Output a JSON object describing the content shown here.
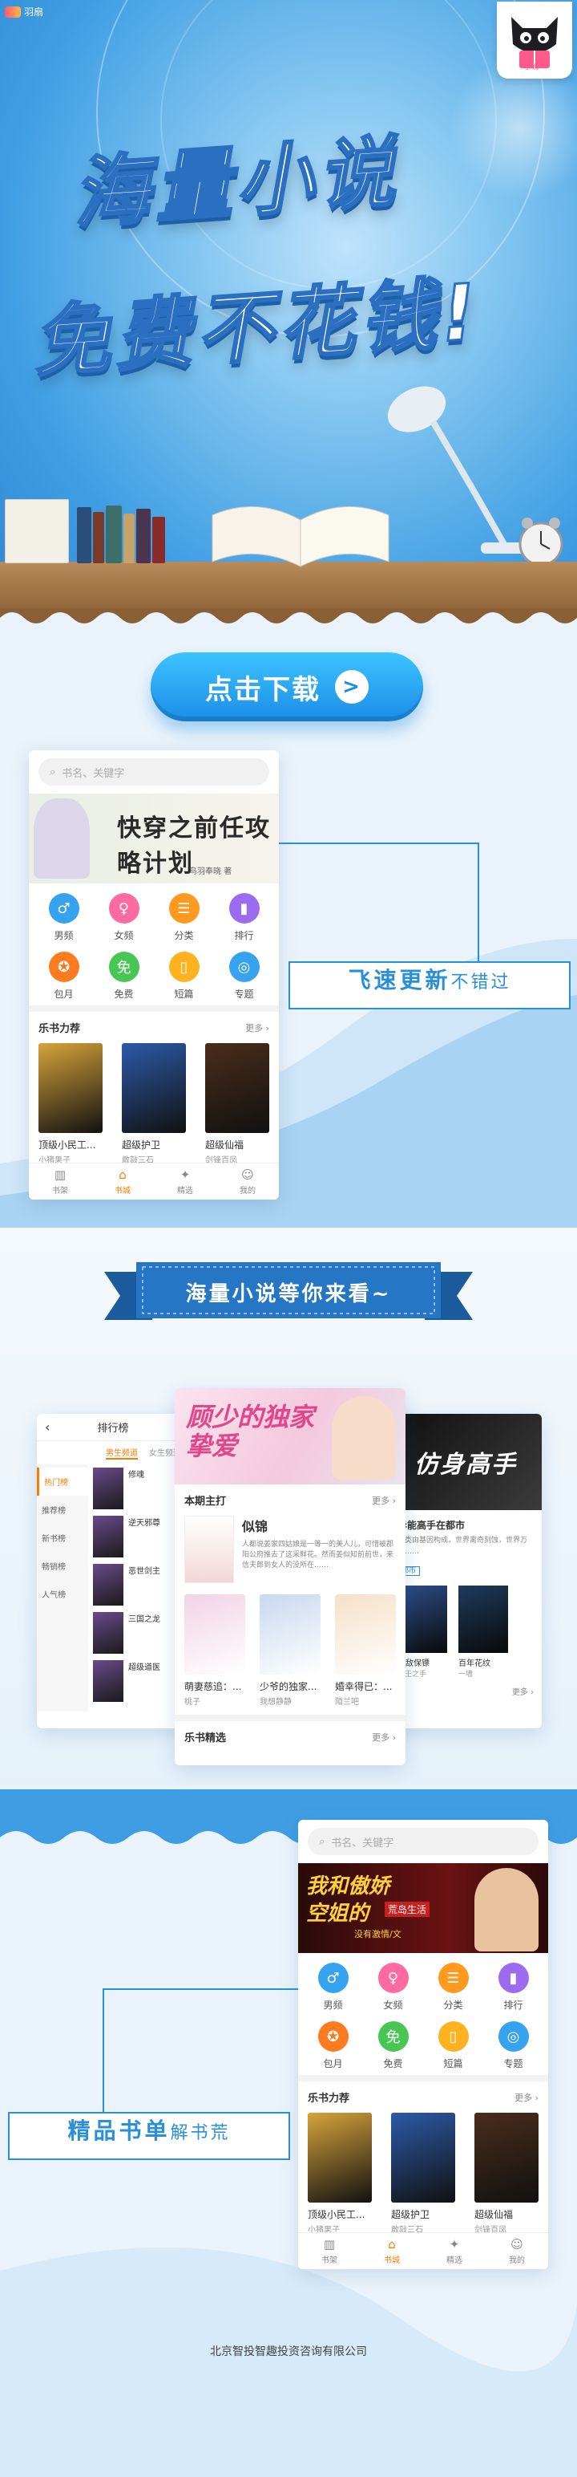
{
  "brand": {
    "name": "羽扇"
  },
  "mascot": {
    "label": "小说"
  },
  "hero": {
    "line1": "海量小说",
    "line2": "免费不花钱!"
  },
  "cta": {
    "label": "点击下载",
    "arrow": ">"
  },
  "app1": {
    "search_placeholder": "书名、关键字",
    "banner_title": "快穿之前任攻略计划",
    "banner_author": "鸟羽奉晓 著",
    "categories": [
      {
        "label": "男频",
        "icon": "male-icon",
        "color": "#35a3ef",
        "glyph": "♂"
      },
      {
        "label": "女频",
        "icon": "female-icon",
        "color": "#ff6aa0",
        "glyph": "♀"
      },
      {
        "label": "分类",
        "icon": "list-icon",
        "color": "#ff9a1f",
        "glyph": "☰"
      },
      {
        "label": "排行",
        "icon": "chart-icon",
        "color": "#9b6cf0",
        "glyph": "▮"
      },
      {
        "label": "包月",
        "icon": "badge-icon",
        "color": "#ff7b1f",
        "glyph": "✪"
      },
      {
        "label": "免费",
        "icon": "free-icon",
        "color": "#48c654",
        "glyph": "免"
      },
      {
        "label": "短篇",
        "icon": "book-icon",
        "color": "#ffb21f",
        "glyph": "▯"
      },
      {
        "label": "专题",
        "icon": "topic-icon",
        "color": "#35a3ef",
        "glyph": "◎"
      }
    ],
    "section_title": "乐书力荐",
    "more": "更多",
    "books": [
      {
        "title": "顶级小民工...",
        "author": "小猪果子",
        "cover": "#d7a33b"
      },
      {
        "title": "超级护卫",
        "author": "敢敲三石",
        "cover": "#2c5aa8"
      },
      {
        "title": "超级仙福",
        "author": "剑锋百凤",
        "cover": "#4a2d1b"
      }
    ],
    "tabs": [
      {
        "label": "书架",
        "icon": "bookshelf-icon",
        "glyph": "▥"
      },
      {
        "label": "书城",
        "icon": "bookstore-icon",
        "glyph": "⌂"
      },
      {
        "label": "精选",
        "icon": "featured-icon",
        "glyph": "✦"
      },
      {
        "label": "我的",
        "icon": "profile-icon",
        "glyph": "☺"
      }
    ]
  },
  "callout1": {
    "bold": "飞速更新",
    "normal": "不错过"
  },
  "ribbon": {
    "text": "海量小说等你来看~"
  },
  "rank": {
    "title": "排行榜",
    "subtabs": [
      "男生频道",
      "女生频道"
    ],
    "side": [
      "热门榜",
      "推荐榜",
      "新书榜",
      "畅销榜",
      "人气榜"
    ],
    "rows": [
      "修魂",
      "逆天邪尊",
      "恶世剑主",
      "三国之龙",
      "超级道医"
    ]
  },
  "center": {
    "banner_title": "顾少的独家挚爱",
    "section": "本期主打",
    "more": "更多",
    "feature_title": "似锦",
    "feature_desc": "人都说姜家四姑娘是一等一的美人儿，可惜被郡阳公府推去了这采鲜花。然而姜似知前前世，来信夫郎到女人的没所在……",
    "books": [
      {
        "title": "萌妻慈追：...",
        "author": "桃子",
        "cover": "#f1d3e4"
      },
      {
        "title": "少爷的独家...",
        "author": "我想静静",
        "cover": "#c9d8ee"
      },
      {
        "title": "婚幸得已：...",
        "author": "陌兰吧",
        "cover": "#f5e0c8"
      }
    ],
    "section2": "乐书精选"
  },
  "right": {
    "banner_title": "仿身高手",
    "feature_title": "异能高手在都市",
    "feature_desc": "人类由基因构成，世界离奇刻蚀，世界万事……",
    "tag": "都市",
    "books": [
      {
        "title": "无敌保镖",
        "author": "叔王之手",
        "cover": "#2d4e8a"
      },
      {
        "title": "百年花纹",
        "author": "一墙",
        "cover": "#1e3b5c"
      }
    ],
    "more": "更多"
  },
  "app2": {
    "search_placeholder": "书名、关键字",
    "banner_line1": "我和傲娇",
    "banner_line2": "空姐的",
    "banner_tag": "荒岛生活",
    "banner_sub": "没有激情/文",
    "section_title": "乐书力荐",
    "more": "更多"
  },
  "callout2": {
    "bold": "精品书单",
    "normal": "解书荒"
  },
  "footer": {
    "company": "北京智投智趣投资咨询有限公司"
  }
}
